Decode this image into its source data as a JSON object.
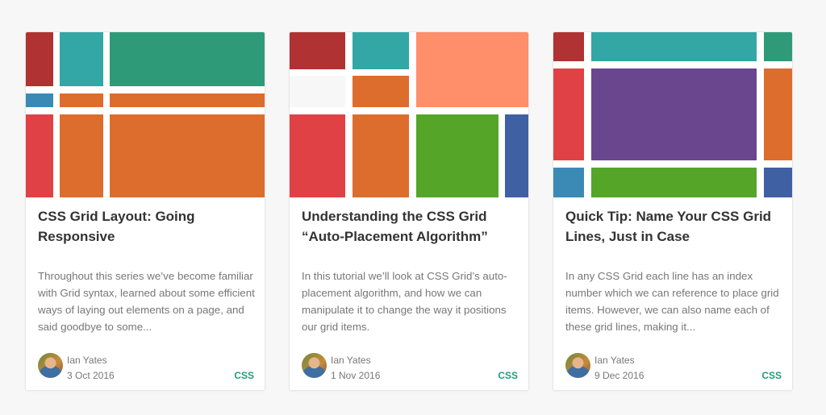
{
  "cards": [
    {
      "title": "CSS Grid Layout: Going Responsive",
      "excerpt": "Throughout this series we’ve become familiar with Grid syntax, learned about some efficient ways of laying out elements on a page, and said goodbye to some...",
      "author": "Ian Yates",
      "date": "3 Oct 2016",
      "tag": "CSS"
    },
    {
      "title": "Understanding the CSS Grid “Auto-Placement Algorithm”",
      "excerpt": "In this tutorial we’ll look at CSS Grid’s auto-placement algorithm, and how we can manipulate it to change the way it positions our grid items.",
      "author": "Ian Yates",
      "date": "1 Nov 2016",
      "tag": "CSS"
    },
    {
      "title": "Quick Tip: Name Your CSS Grid Lines, Just in Case",
      "excerpt": "In any CSS Grid each line has an index number which we can reference to place grid items. However, we can also name each of these grid lines, making it...",
      "author": "Ian Yates",
      "date": "9 Dec 2016",
      "tag": "CSS"
    }
  ],
  "colors": {
    "red_dark": "#b03232",
    "red": "#e04144",
    "teal": "#33a6a6",
    "green": "#2f9a78",
    "blue": "#3b8ab6",
    "orange": "#dd6d2c",
    "salmon": "#ff8e6a",
    "lime": "#55a528",
    "navy": "#4060a4",
    "purple": "#6a468e",
    "tag": "#1f9e7a"
  }
}
